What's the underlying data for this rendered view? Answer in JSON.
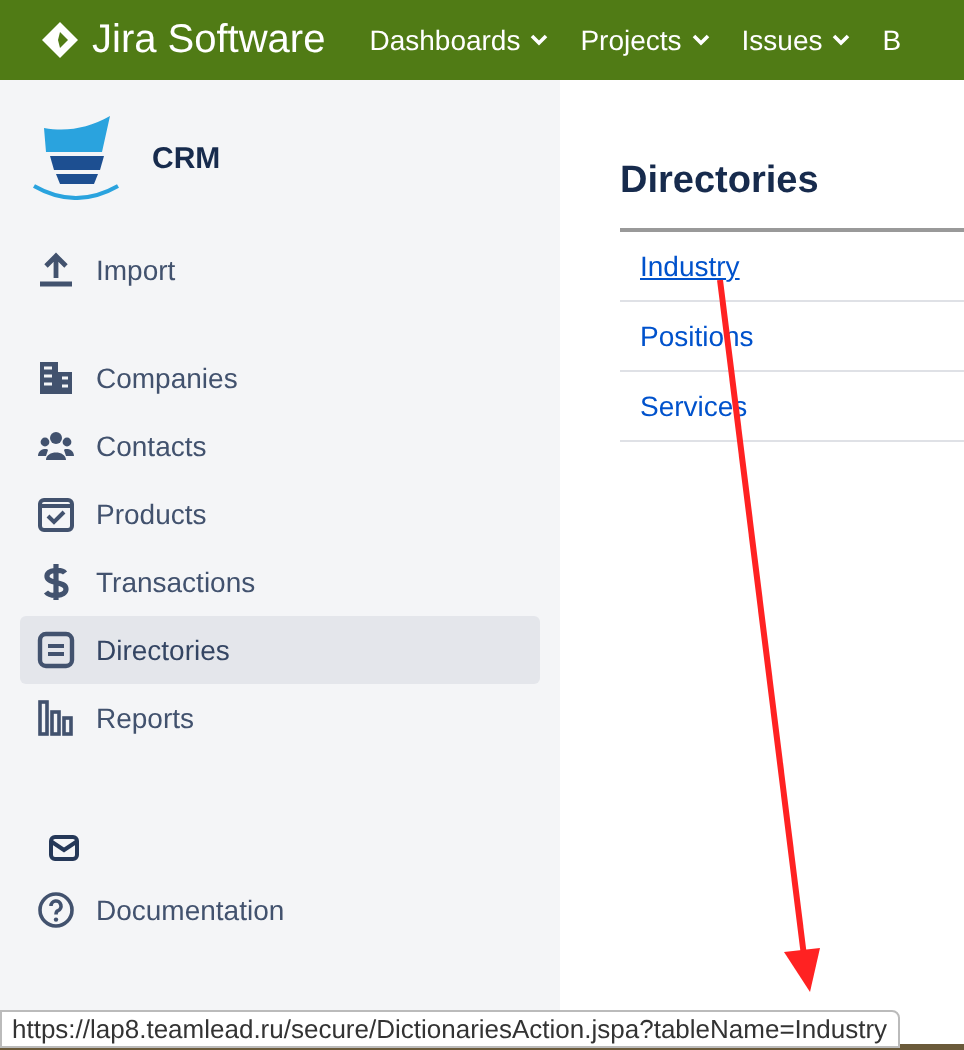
{
  "header": {
    "product": "Jira Software",
    "menus": [
      {
        "label": "Dashboards",
        "caret": true
      },
      {
        "label": "Projects",
        "caret": true
      },
      {
        "label": "Issues",
        "caret": true
      },
      {
        "label": "B",
        "caret": false
      }
    ]
  },
  "sidebar": {
    "project": "CRM",
    "groups": [
      [
        {
          "label": "Import",
          "selected": false
        }
      ],
      [
        {
          "label": "Companies",
          "selected": false
        },
        {
          "label": "Contacts",
          "selected": false
        },
        {
          "label": "Products",
          "selected": false
        },
        {
          "label": "Transactions",
          "selected": false
        },
        {
          "label": "Directories",
          "selected": true
        },
        {
          "label": "Reports",
          "selected": false
        }
      ]
    ],
    "footer": [
      {
        "label": "Documentation",
        "selected": false
      }
    ]
  },
  "main": {
    "title": "Directories",
    "links": [
      {
        "label": "Industry",
        "hovered": true
      },
      {
        "label": "Positions",
        "hovered": false
      },
      {
        "label": "Services",
        "hovered": false
      }
    ]
  },
  "status_url": "https://lap8.teamlead.ru/secure/DictionariesAction.jspa?tableName=Industry"
}
